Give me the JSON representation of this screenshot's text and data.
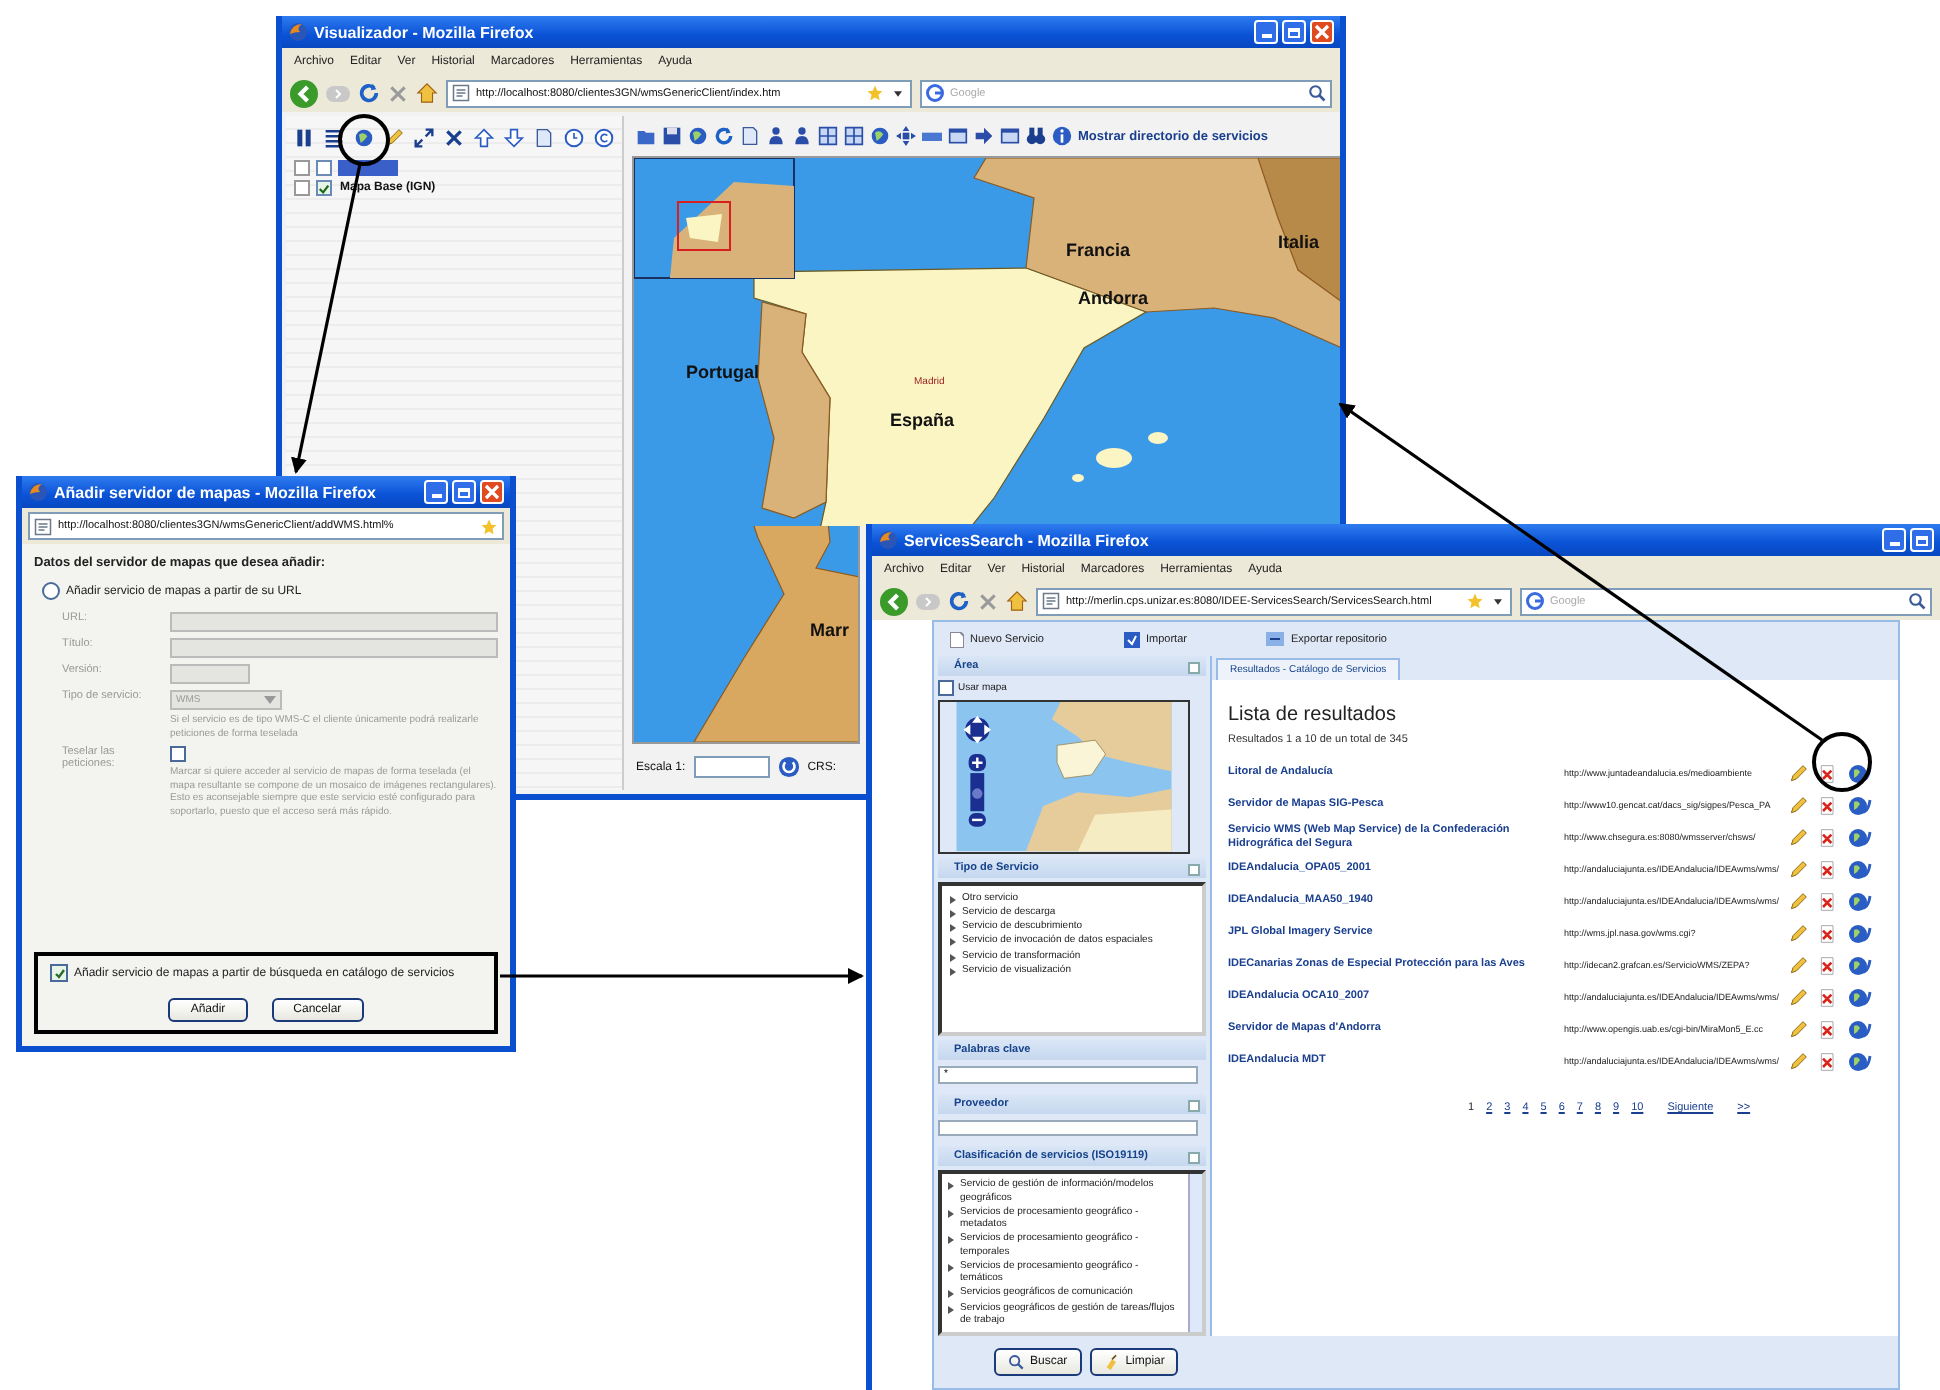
{
  "viewer_window": {
    "title": "Visualizador - Mozilla Firefox",
    "menu": [
      "Archivo",
      "Editar",
      "Ver",
      "Historial",
      "Marcadores",
      "Herramientas",
      "Ayuda"
    ],
    "url": "http://localhost:8080/clientes3GN/wmsGenericClient/index.htm",
    "search_placeholder": "Google",
    "layers": [
      {
        "checked": false,
        "selected": true
      },
      {
        "label": "Mapa Base (IGN)",
        "checked": true,
        "selected": false
      }
    ],
    "map_toolbar_label": "Mostrar directorio de servicios",
    "map_labels": [
      {
        "text": "Francia",
        "kind": "country"
      },
      {
        "text": "Italia",
        "kind": "country"
      },
      {
        "text": "Andorra",
        "kind": "country"
      },
      {
        "text": "Portugal",
        "kind": "country"
      },
      {
        "text": "Madrid",
        "kind": "city"
      },
      {
        "text": "España",
        "kind": "country"
      },
      {
        "text": "Marr",
        "kind": "country"
      }
    ],
    "scale_label": "Escala 1:",
    "crs_label": "CRS:"
  },
  "add_server_dialog": {
    "title": "Añadir servidor de mapas - Mozilla Firefox",
    "url": "http://localhost:8080/clientes3GN/wmsGenericClient/addWMS.html%",
    "heading": "Datos del servidor de mapas que desea añadir:",
    "fields_disabled": true,
    "options": [
      {
        "kind": "radio",
        "label": "Añadir servicio de mapas a partir de su URL",
        "checked": false
      },
      {
        "kind": "checkbox",
        "label": "Añadir servicio de mapas a partir de búsqueda en catálogo de servicios",
        "checked": true
      }
    ],
    "fields": [
      {
        "kind": "text",
        "label": "URL:"
      },
      {
        "kind": "text",
        "label": "Título:"
      },
      {
        "kind": "short",
        "label": "Versión:"
      },
      {
        "kind": "select",
        "label": "Tipo de servicio:",
        "value": "WMS",
        "note": "Si el servicio es de tipo WMS-C el cliente únicamente podrá realizarle peticiones de forma teselada"
      },
      {
        "kind": "checkbox",
        "label": "Teselar las peticiones:",
        "checked": false,
        "note": "Marcar si quiere acceder al servicio de mapas de forma teselada (el mapa resultante se compone de un mosaico de imágenes rectangulares). Esto es aconsejable siempre que este servicio esté configurado para soportarlo, puesto que el acceso será más rápido."
      }
    ],
    "buttons": [
      "Añadir",
      "Cancelar"
    ]
  },
  "services_window": {
    "title": "ServicesSearch - Mozilla Firefox",
    "menu": [
      "Archivo",
      "Editar",
      "Ver",
      "Historial",
      "Marcadores",
      "Herramientas",
      "Ayuda"
    ],
    "url": "http://merlin.cps.unizar.es:8080/IDEE-ServicesSearch/ServicesSearch.html",
    "search_placeholder": "Google",
    "toolbar": [
      "Nuevo Servicio",
      "Importar",
      "Exportar repositorio"
    ],
    "area": {
      "title": "Área",
      "use_map_label": "Usar mapa",
      "use_map_checked": false,
      "zoom_slider": {
        "level": 0.45
      }
    },
    "service_types": {
      "title": "Tipo de Servicio",
      "items": [
        "Otro servicio",
        "Servicio de descarga",
        "Servicio de descubrimiento",
        "Servicio de invocación de datos espaciales",
        "Servicio de transformación",
        "Servicio de visualización"
      ]
    },
    "keywords": {
      "title": "Palabras clave",
      "value": "*"
    },
    "provider": {
      "title": "Proveedor"
    },
    "classification": {
      "title": "Clasificación de servicios (ISO19119)",
      "items": [
        "Servicio de gestión de información/modelos geográficos",
        "Servicios de procesamiento geográfico - metadatos",
        "Servicios de procesamiento geográfico - temporales",
        "Servicios de procesamiento geográfico - temáticos",
        "Servicios geográficos de comunicación",
        "Servicios geográficos de gestión de tareas/flujos de trabajo"
      ]
    },
    "buttons": [
      "Buscar",
      "Limpiar"
    ],
    "tab": "Resultados - Catálogo de Servicios",
    "heading": "Lista de resultados",
    "summary": "Resultados 1 a 10 de un total de 345",
    "results": [
      {
        "name": "Litoral de Andalucía",
        "url": "http://www.juntadeandalucia.es/medioambiente"
      },
      {
        "name": "Servidor de Mapas SIG-Pesca",
        "url": "http://www10.gencat.cat/dacs_sig/sigpes/Pesca_PA"
      },
      {
        "name": "Servicio WMS (Web Map Service) de la Confederación Hidrográfica del Segura",
        "url": "http://www.chsegura.es:8080/wmsserver/chsws/"
      },
      {
        "name": "IDEAndalucia_OPA05_2001",
        "url": "http://andaluciajunta.es/IDEAndalucia/IDEAwms/wms/"
      },
      {
        "name": "IDEAndalucia_MAA50_1940",
        "url": "http://andaluciajunta.es/IDEAndalucia/IDEAwms/wms/"
      },
      {
        "name": "JPL Global Imagery Service",
        "url": "http://wms.jpl.nasa.gov/wms.cgi?"
      },
      {
        "name": "IDECanarias Zonas de Especial Protección para las Aves",
        "url": "http://idecan2.grafcan.es/ServicioWMS/ZEPA?"
      },
      {
        "name": "IDEAndalucia OCA10_2007",
        "url": "http://andaluciajunta.es/IDEAndalucia/IDEAwms/wms/"
      },
      {
        "name": "Servidor de Mapas d'Andorra",
        "url": "http://www.opengis.uab.es/cgi-bin/MiraMon5_E.cc"
      },
      {
        "name": "IDEAndalucia MDT",
        "url": "http://andaluciajunta.es/IDEAndalucia/IDEAwms/wms/"
      }
    ],
    "pages": [
      {
        "label": "1",
        "selected": true
      },
      {
        "label": "2",
        "selected": false
      },
      {
        "label": "3",
        "selected": false
      },
      {
        "label": "4",
        "selected": false
      },
      {
        "label": "5",
        "selected": false
      },
      {
        "label": "6",
        "selected": false
      },
      {
        "label": "7",
        "selected": false
      },
      {
        "label": "8",
        "selected": false
      },
      {
        "label": "9",
        "selected": false
      },
      {
        "label": "10",
        "selected": false
      }
    ],
    "next": "Siguiente",
    "last": ">>"
  }
}
